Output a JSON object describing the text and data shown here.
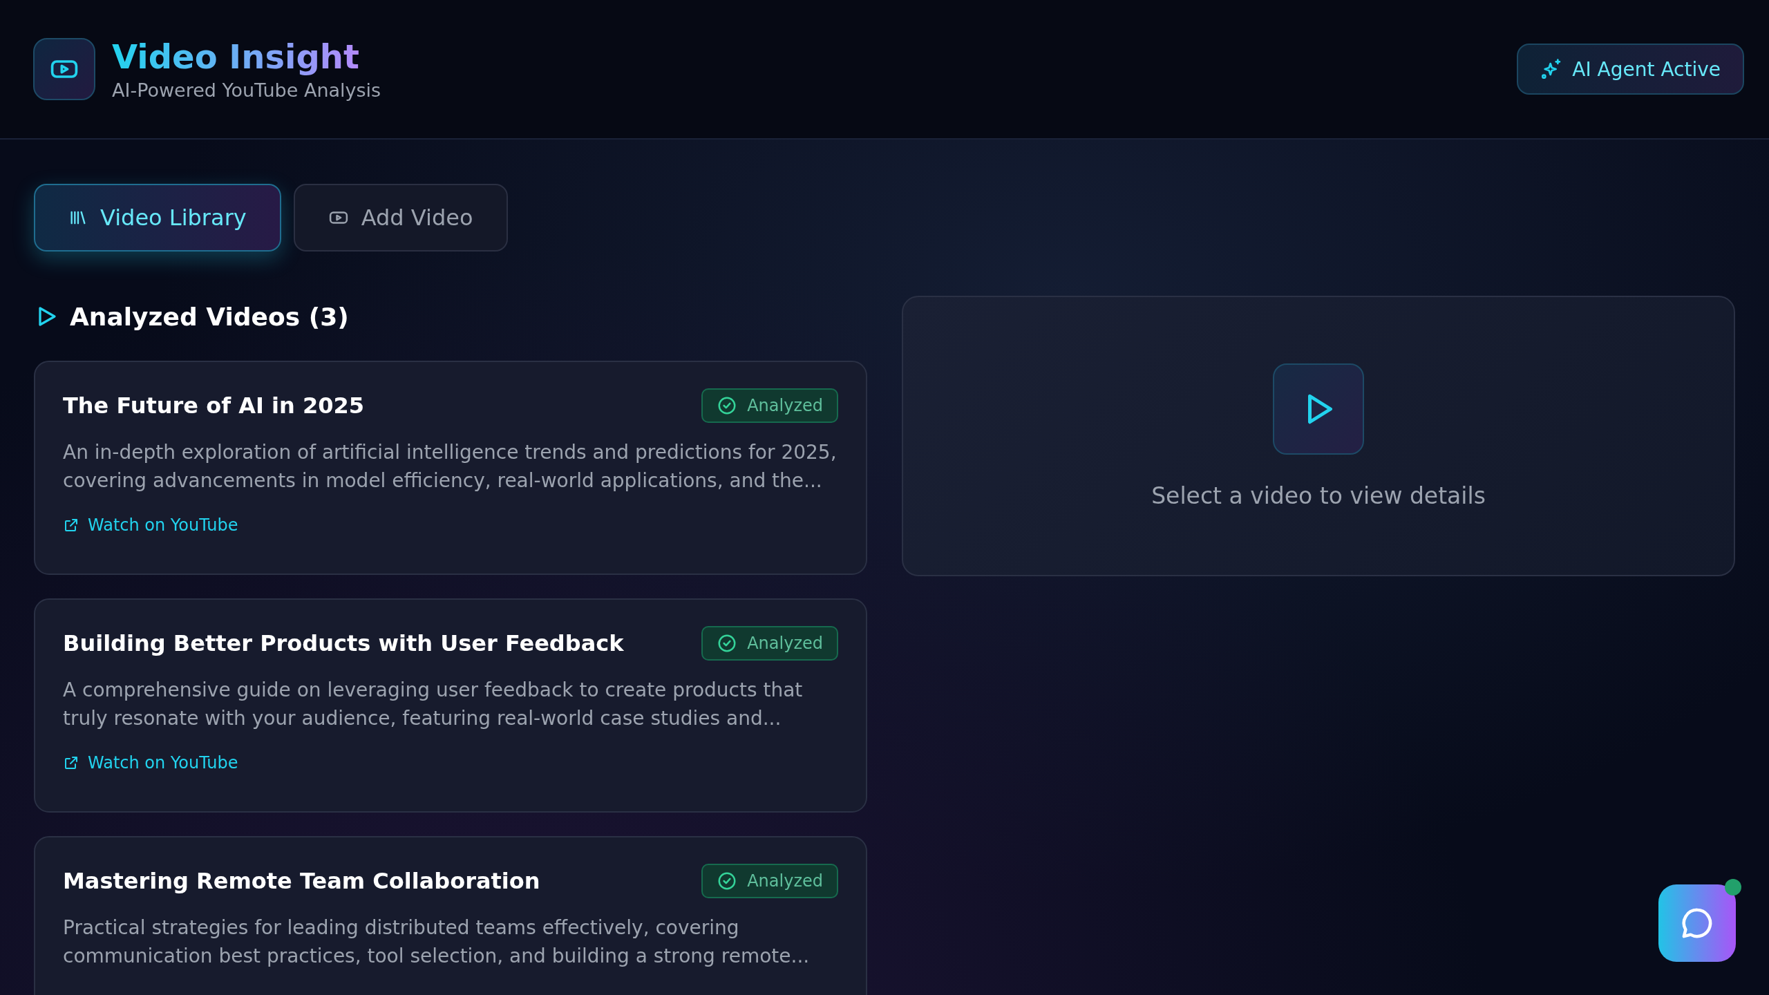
{
  "header": {
    "title": "Video Insight",
    "subtitle": "AI-Powered YouTube Analysis",
    "status": "AI Agent Active"
  },
  "tabs": [
    {
      "label": "Video Library",
      "kind": "library",
      "selected": true
    },
    {
      "label": "Add Video",
      "kind": "add",
      "selected": false
    }
  ],
  "section_title": "Analyzed Videos (3)",
  "videos": [
    {
      "title": "The Future of AI in 2025",
      "badge": "Analyzed",
      "description": "An in-depth exploration of artificial intelligence trends and predictions for 2025, covering advancements in model efficiency, real-world applications, and the...",
      "link": "Watch on YouTube"
    },
    {
      "title": "Building Better Products with User Feedback",
      "badge": "Analyzed",
      "description": "A comprehensive guide on leveraging user feedback to create products that truly resonate with your audience, featuring real-world case studies and...",
      "link": "Watch on YouTube"
    },
    {
      "title": "Mastering Remote Team Collaboration",
      "badge": "Analyzed",
      "description": "Practical strategies for leading distributed teams effectively, covering communication best practices, tool selection, and building a strong remote..."
    }
  ],
  "details": {
    "message": "Select a video to view details"
  },
  "chat": {
    "online": true
  }
}
